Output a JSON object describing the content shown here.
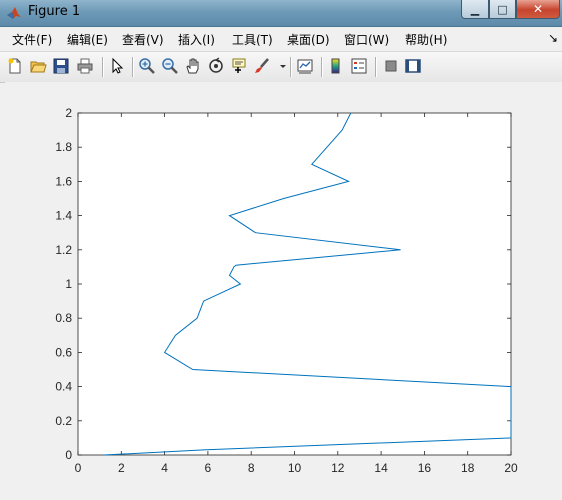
{
  "window": {
    "title": "Figure 1",
    "min_label": "▁",
    "max_label": "□",
    "close_label": "✕"
  },
  "menu": {
    "items": [
      "文件(F)",
      "编辑(E)",
      "查看(V)",
      "插入(I)",
      "工具(T)",
      "桌面(D)",
      "窗口(W)",
      "帮助(H)"
    ],
    "overflow_icon": "chevron-icon"
  },
  "toolbar": {
    "buttons": [
      "new-figure-icon",
      "open-file-icon",
      "save-icon",
      "print-icon",
      "select-arrow-icon",
      "zoom-in-icon",
      "zoom-out-icon",
      "pan-hand-icon",
      "rotate-3d-icon",
      "data-cursor-icon",
      "brush-icon",
      "link-plot-icon",
      "colorbar-icon",
      "legend-icon",
      "hide-plot-tools-icon",
      "show-plot-tools-icon"
    ]
  },
  "colors": {
    "line": "#0072bd",
    "axes_bg": "#ffffff",
    "figure_bg": "#f0f0f0"
  },
  "chart_data": {
    "type": "line",
    "title": "",
    "xlabel": "",
    "ylabel": "",
    "xlim": [
      0,
      20
    ],
    "ylim": [
      0,
      2
    ],
    "xticks": [
      "0",
      "2",
      "4",
      "6",
      "8",
      "10",
      "12",
      "14",
      "16",
      "18",
      "20"
    ],
    "yticks": [
      "0",
      "0.2",
      "0.4",
      "0.6",
      "0.8",
      "1",
      "1.2",
      "1.4",
      "1.6",
      "1.8",
      "2"
    ],
    "grid": false,
    "series": [
      {
        "x": [
          1.2,
          5.8,
          20,
          20,
          5.3,
          4.0,
          4.5,
          5.5,
          5.8,
          7.5,
          7.0,
          7.2,
          7.3,
          14.9,
          8.2,
          7.0,
          9.5,
          12.5,
          10.8,
          11.5,
          12.2,
          12.6
        ],
        "y": [
          0.0,
          0.03,
          0.1,
          0.4,
          0.5,
          0.6,
          0.7,
          0.8,
          0.9,
          1.0,
          1.05,
          1.1,
          1.11,
          1.2,
          1.3,
          1.4,
          1.5,
          1.6,
          1.7,
          1.8,
          1.9,
          2.0
        ]
      }
    ]
  }
}
